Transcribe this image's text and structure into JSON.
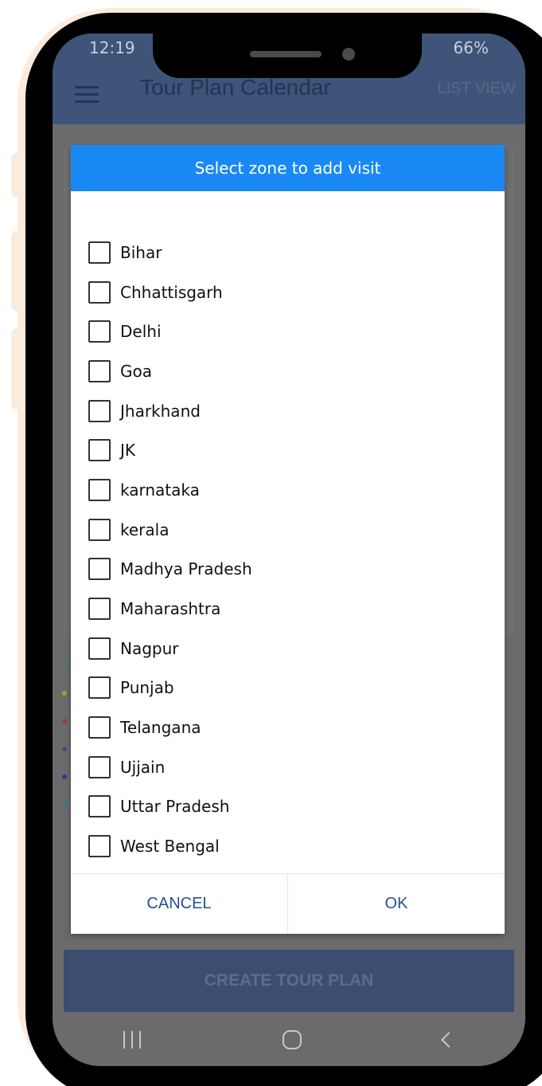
{
  "status_bar": {
    "time": "12:19",
    "signal_battery": "66%"
  },
  "app_bar": {
    "title": "Tour Plan Calendar",
    "list_view": "LIST VIEW"
  },
  "dialog": {
    "title": "Select zone to add visit",
    "zones": [
      {
        "label": "Bihar",
        "checked": false
      },
      {
        "label": "Chhattisgarh",
        "checked": false
      },
      {
        "label": "Delhi",
        "checked": false
      },
      {
        "label": "Goa",
        "checked": false
      },
      {
        "label": "Jharkhand",
        "checked": false
      },
      {
        "label": "JK",
        "checked": false
      },
      {
        "label": "karnataka",
        "checked": false
      },
      {
        "label": "kerala",
        "checked": false
      },
      {
        "label": "Madhya Pradesh",
        "checked": false
      },
      {
        "label": "Maharashtra",
        "checked": false
      },
      {
        "label": "Nagpur",
        "checked": false
      },
      {
        "label": "Punjab",
        "checked": false
      },
      {
        "label": "Telangana",
        "checked": false
      },
      {
        "label": "Ujjain",
        "checked": false
      },
      {
        "label": "Uttar Pradesh",
        "checked": false
      },
      {
        "label": "West Bengal",
        "checked": false
      }
    ],
    "cancel_label": "CANCEL",
    "ok_label": "OK"
  },
  "create_button": {
    "label": "CREATE TOUR PLAN"
  },
  "legend_dot_colors": [
    "#3f8a52",
    "#a3a03a",
    "#9a3f35",
    "#5a3f86",
    "#2f3a8c",
    "#2f7f8f"
  ],
  "colors": {
    "app_bar": "#3e5478",
    "dialog_header": "#1a89f3",
    "action_text": "#24518e",
    "phone_frame": "#fcebdc"
  }
}
